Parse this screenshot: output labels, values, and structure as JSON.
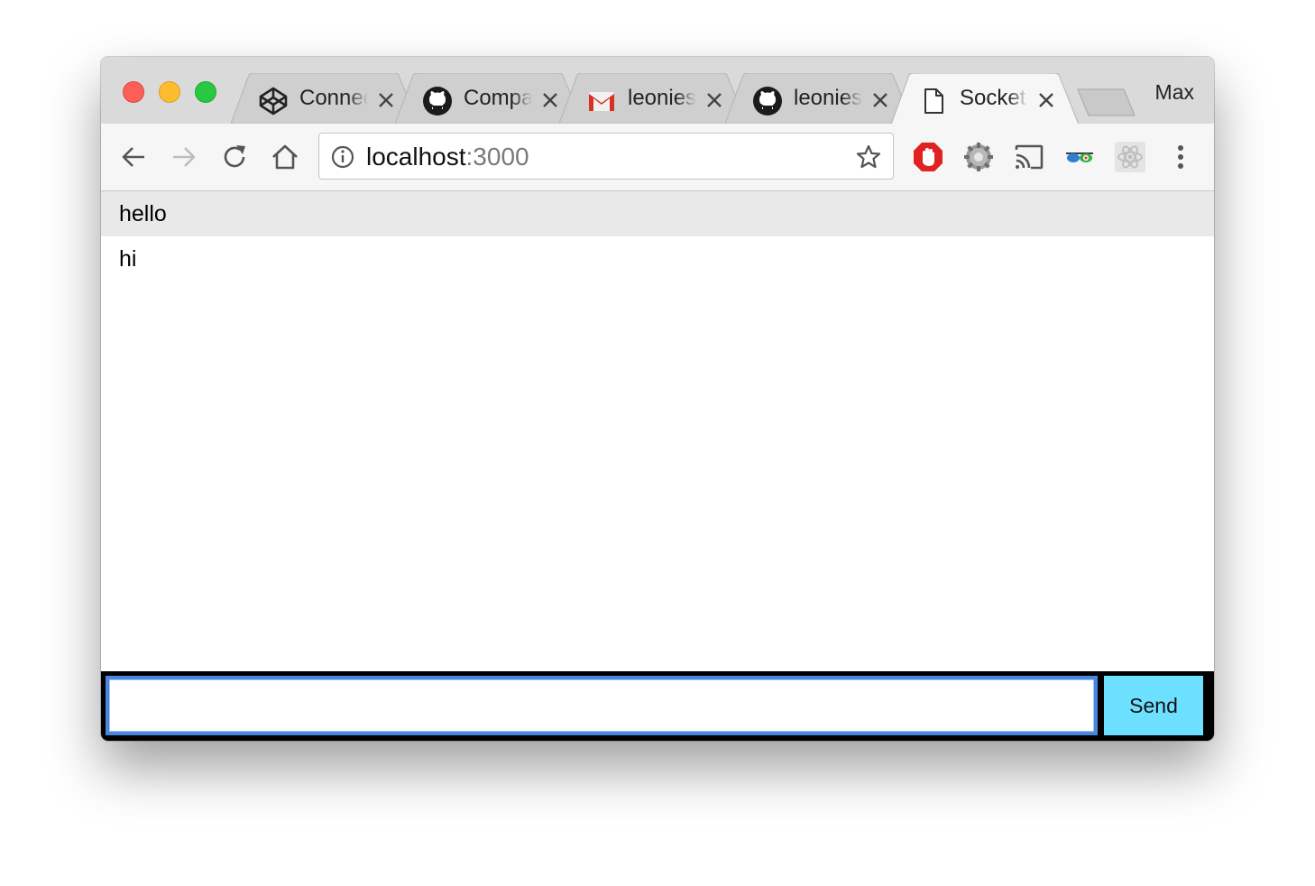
{
  "window": {
    "traffic_lights": [
      "close",
      "minimize",
      "zoom"
    ],
    "profile_name": "Max"
  },
  "tabs": [
    {
      "title": "Connect to a server",
      "icon": "codepen-icon",
      "active": false
    },
    {
      "title": "Compare changes",
      "icon": "github-icon",
      "active": false
    },
    {
      "title": "leonies mail",
      "icon": "gmail-icon",
      "active": false
    },
    {
      "title": "leonies repository",
      "icon": "github-icon",
      "active": false
    },
    {
      "title": "Socket.IO chat",
      "icon": "page-icon",
      "active": true
    }
  ],
  "toolbar": {
    "url_host": "localhost",
    "url_port": ":3000",
    "extensions": [
      "adblock-icon",
      "settings-gear-icon",
      "cast-icon",
      "glasses-icon",
      "react-devtools-icon"
    ]
  },
  "messages": [
    "hello",
    "hi"
  ],
  "form": {
    "input_value": "",
    "send_label": "Send"
  },
  "colors": {
    "send_button": "#6ee0ff",
    "input_focus": "#4a86e0",
    "form_bar": "#000000",
    "odd_message": "#e9e9e9"
  }
}
